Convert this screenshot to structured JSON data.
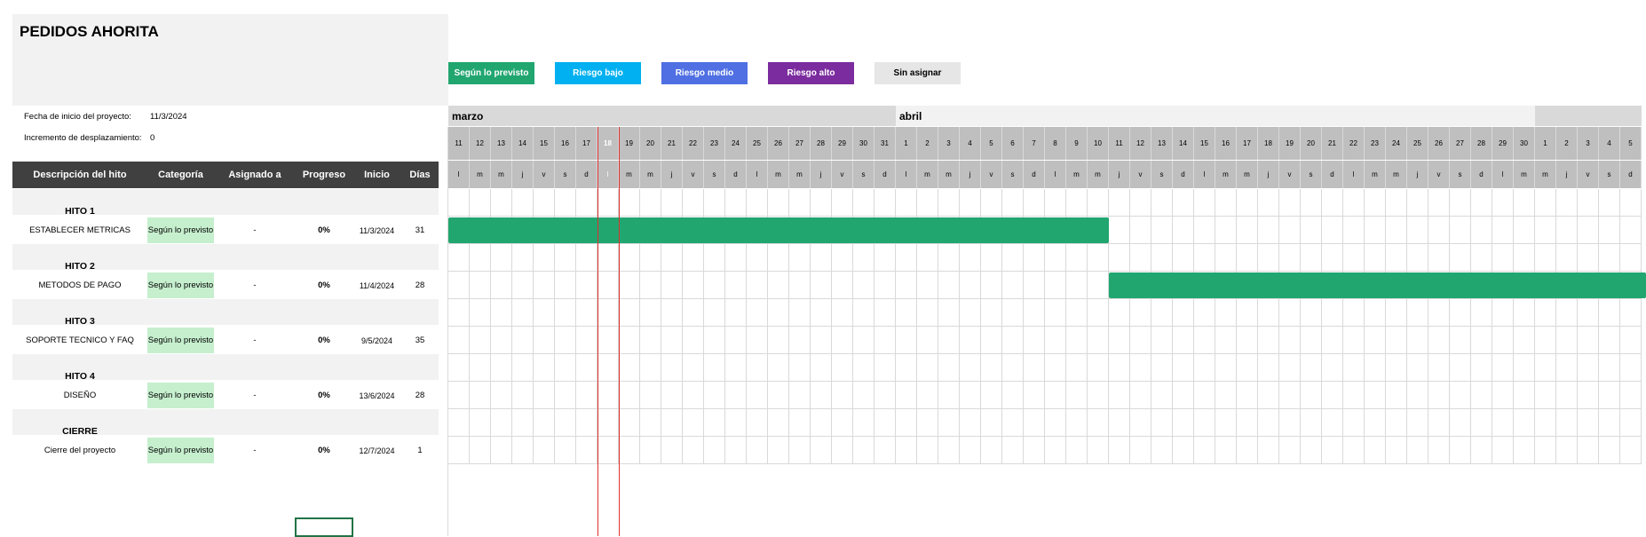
{
  "title": "PEDIDOS AHORITA",
  "project_info": {
    "start_label": "Fecha de inicio del proyecto:",
    "start_value": "11/3/2024",
    "increment_label": "Incremento de desplazamiento:",
    "increment_value": "0"
  },
  "legend": [
    {
      "label": "Según lo previsto",
      "color": "#21a670",
      "text_color": "#ffffff"
    },
    {
      "label": "Riesgo bajo",
      "color": "#00b0f0",
      "text_color": "#ffffff"
    },
    {
      "label": "Riesgo medio",
      "color": "#4f6fe3",
      "text_color": "#ffffff"
    },
    {
      "label": "Riesgo alto",
      "color": "#7b2c9e",
      "text_color": "#ffffff"
    },
    {
      "label": "Sin asignar",
      "color": "#e6e6e6",
      "text_color": "#000000"
    }
  ],
  "table_headers": [
    "Descripción del hito",
    "Categoría",
    "Asignado a",
    "Progreso",
    "Inicio",
    "Días"
  ],
  "rows": [
    {
      "type": "milestone",
      "label": "HITO 1"
    },
    {
      "type": "task",
      "desc": "ESTABLECER METRICAS",
      "category": "Según lo previsto",
      "assigned": "-",
      "progress": "0%",
      "start": "11/3/2024",
      "days": "31",
      "bar_start_index": 0,
      "bar_days": 31
    },
    {
      "type": "milestone",
      "label": "HITO 2"
    },
    {
      "type": "task",
      "desc": "METODOS DE PAGO",
      "category": "Según lo previsto",
      "assigned": "-",
      "progress": "0%",
      "start": "11/4/2024",
      "days": "28",
      "bar_start_index": 31,
      "bar_days": 28
    },
    {
      "type": "milestone",
      "label": "HITO 3"
    },
    {
      "type": "task",
      "desc": "SOPORTE TECNICO Y FAQ",
      "category": "Según lo previsto",
      "assigned": "-",
      "progress": "0%",
      "start": "9/5/2024",
      "days": "35",
      "bar_start_index": 59,
      "bar_days": 35
    },
    {
      "type": "milestone",
      "label": "HITO 4"
    },
    {
      "type": "task",
      "desc": "DISEÑO",
      "category": "Según lo previsto",
      "assigned": "-",
      "progress": "0%",
      "start": "13/6/2024",
      "days": "28",
      "bar_start_index": 94,
      "bar_days": 28
    },
    {
      "type": "milestone",
      "label": "CIERRE"
    },
    {
      "type": "task",
      "desc": "Cierre del proyecto",
      "category": "Según lo previsto",
      "assigned": "-",
      "progress": "0%",
      "start": "12/7/2024",
      "days": "1",
      "bar_start_index": 123,
      "bar_days": 1
    }
  ],
  "months": [
    {
      "label": "marzo",
      "days": 21
    },
    {
      "label": "abril",
      "days": 30
    },
    {
      "label": "",
      "days": 5
    }
  ],
  "day_numbers": [
    "11",
    "12",
    "13",
    "14",
    "15",
    "16",
    "17",
    "18",
    "19",
    "20",
    "21",
    "22",
    "23",
    "24",
    "25",
    "26",
    "27",
    "28",
    "29",
    "30",
    "31",
    "1",
    "2",
    "3",
    "4",
    "5",
    "6",
    "7",
    "8",
    "9",
    "10",
    "11",
    "12",
    "13",
    "14",
    "15",
    "16",
    "17",
    "18",
    "19",
    "20",
    "21",
    "22",
    "23",
    "24",
    "25",
    "26",
    "27",
    "28",
    "29",
    "30",
    "1",
    "2",
    "3",
    "4",
    "5"
  ],
  "day_letters": [
    "l",
    "m",
    "m",
    "j",
    "v",
    "s",
    "d",
    "l",
    "m",
    "m",
    "j",
    "v",
    "s",
    "d",
    "l",
    "m",
    "m",
    "j",
    "v",
    "s",
    "d",
    "l",
    "m",
    "m",
    "j",
    "v",
    "s",
    "d",
    "l",
    "m",
    "m",
    "j",
    "v",
    "s",
    "d",
    "l",
    "m",
    "m",
    "j",
    "v",
    "s",
    "d",
    "l",
    "m",
    "m",
    "j",
    "v",
    "s",
    "d",
    "l",
    "m",
    "m",
    "j",
    "v",
    "s",
    "d"
  ],
  "today_index": 7,
  "colors": {
    "on_track": "#21a670",
    "header_dark": "#404040",
    "category_fill": "#c6efce",
    "today_line": "#e03030"
  }
}
